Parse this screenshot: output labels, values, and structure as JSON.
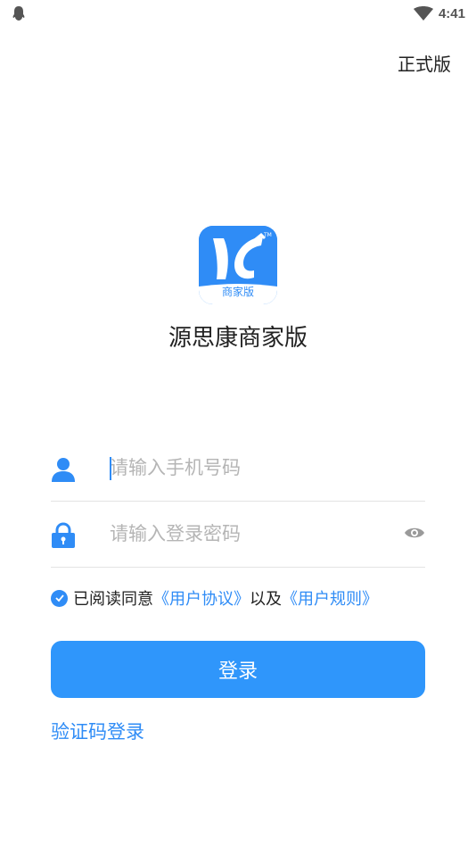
{
  "status_bar": {
    "time": "4:41"
  },
  "header": {
    "version_label": "正式版"
  },
  "branding": {
    "logo_badge_text": "商家版",
    "app_name": "源思康商家版"
  },
  "form": {
    "phone_placeholder": "请输入手机号码",
    "password_placeholder": "请输入登录密码"
  },
  "agreement": {
    "prefix": "已阅读同意",
    "user_agreement": "《用户协议》",
    "middle": "以及",
    "user_rules": "《用户规则》"
  },
  "actions": {
    "login_label": "登录",
    "code_login_label": "验证码登录"
  },
  "colors": {
    "accent": "#2f8cf6",
    "button": "#2f96fb"
  }
}
